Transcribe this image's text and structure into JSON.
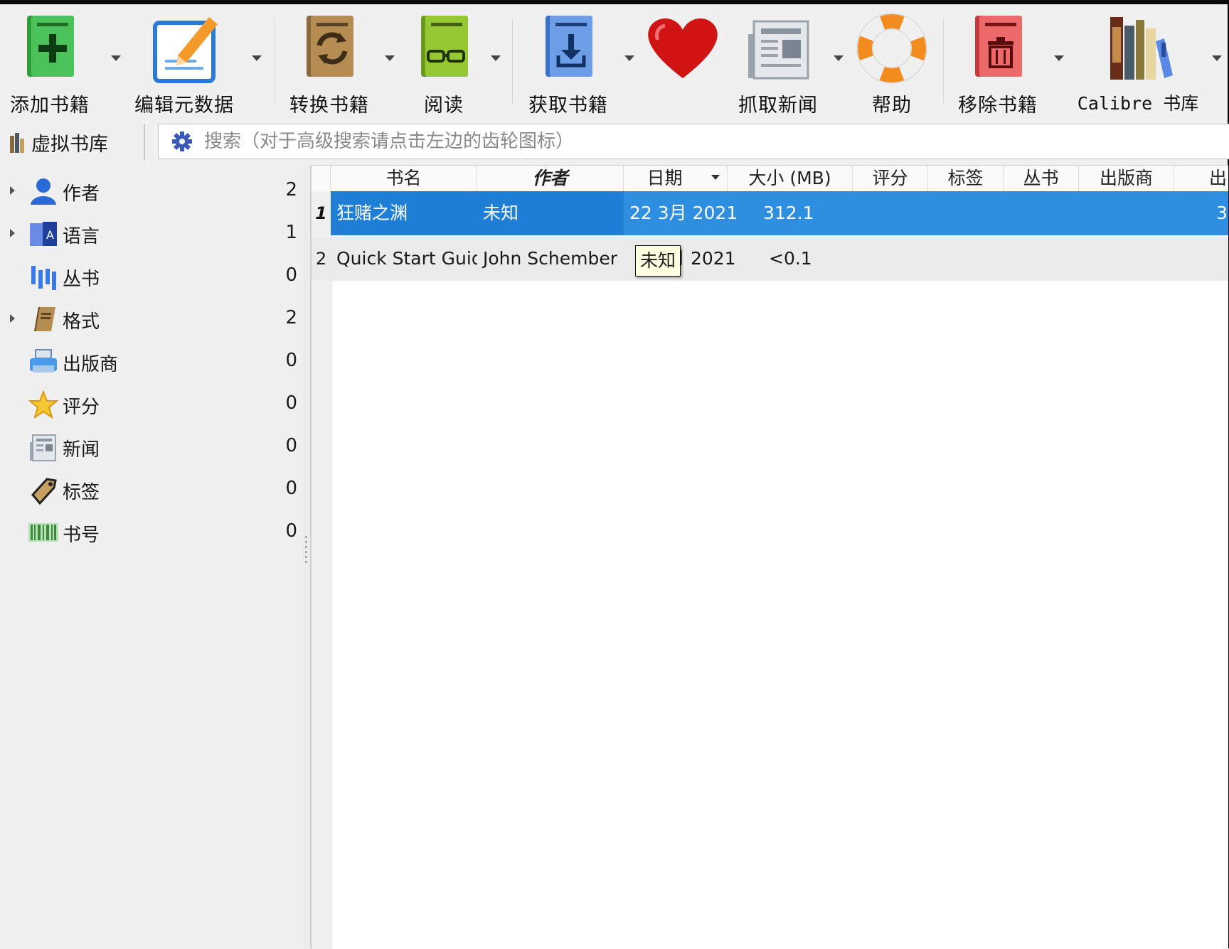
{
  "toolbar": {
    "add_books": "添加书籍",
    "edit_metadata": "编辑元数据",
    "convert_books": "转换书籍",
    "view": "阅读",
    "get_books": "获取书籍",
    "fetch_news": "抓取新闻",
    "help": "帮助",
    "remove_books": "移除书籍",
    "calibre_library": "Calibre 书库"
  },
  "searchbar": {
    "virtual_library": "虚拟书库",
    "placeholder": "搜索（对于高级搜索请点击左边的齿轮图标）"
  },
  "tag_browser": [
    {
      "label": "作者",
      "count": "2",
      "icon": "person-icon"
    },
    {
      "label": "语言",
      "count": "1",
      "icon": "language-icon"
    },
    {
      "label": "丛书",
      "count": "0",
      "icon": "series-icon"
    },
    {
      "label": "格式",
      "count": "2",
      "icon": "format-book-icon"
    },
    {
      "label": "出版商",
      "count": "0",
      "icon": "publisher-icon"
    },
    {
      "label": "评分",
      "count": "0",
      "icon": "star-icon"
    },
    {
      "label": "新闻",
      "count": "0",
      "icon": "news-icon"
    },
    {
      "label": "标签",
      "count": "0",
      "icon": "tag-icon"
    },
    {
      "label": "书号",
      "count": "0",
      "icon": "barcode-icon"
    }
  ],
  "columns": [
    "书名",
    "作者",
    "日期",
    "大小 (MB)",
    "评分",
    "标签",
    "丛书",
    "出版商",
    "出"
  ],
  "books": [
    {
      "num": "1",
      "title": "狂赌之渊",
      "author": "未知",
      "date": "22 3月 2021",
      "size": "312.1",
      "extra": "3"
    },
    {
      "num": "2",
      "title": "Quick Start Guide",
      "author": "John Schember",
      "date_partial": "月 2021",
      "size": "<0.1"
    }
  ],
  "tooltip": "未知",
  "colors": {
    "selection": "#2e8ee0",
    "tooltip_bg": "#ffffe1"
  }
}
